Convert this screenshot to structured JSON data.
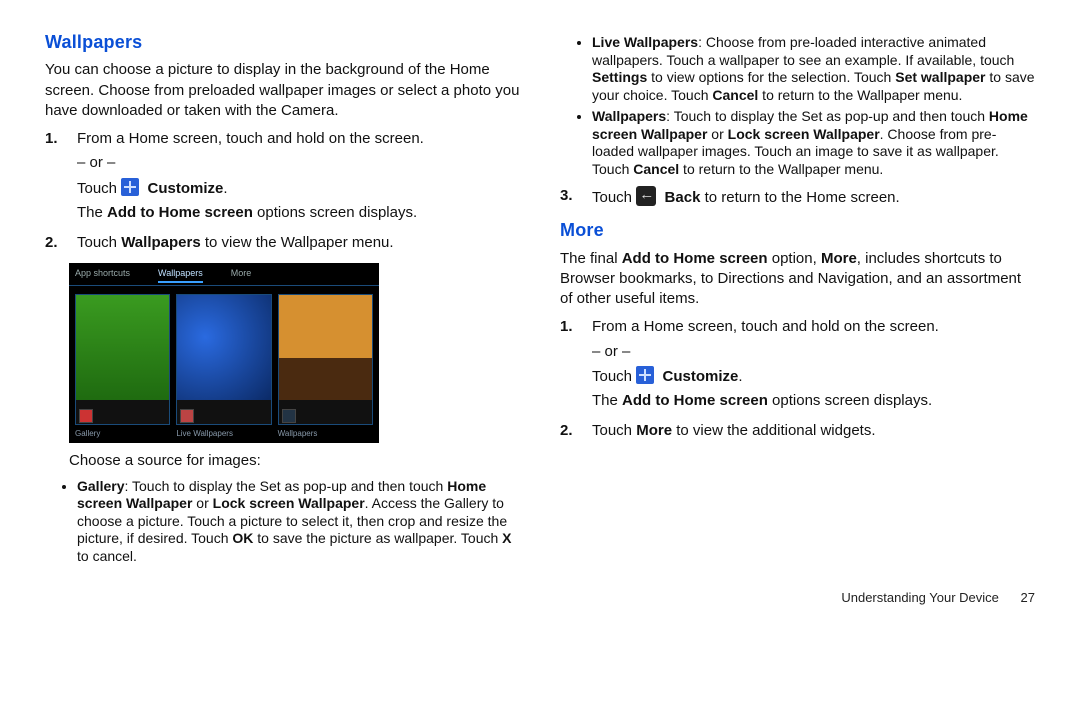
{
  "left": {
    "heading": "Wallpapers",
    "intro": "You can choose a picture to display in the background of the Home screen. Choose from preloaded wallpaper images or select a photo you have downloaded or taken with the Camera.",
    "steps": {
      "s1a": "From a Home screen, touch and hold on the screen.",
      "s1b": "– or –",
      "s1c_pre": "Touch ",
      "s1c_bold": "Customize",
      "s1d_pre": "The ",
      "s1d_bold": "Add to Home screen",
      "s1d_post": " options screen displays.",
      "s2_pre": "Touch ",
      "s2_bold": "Wallpapers",
      "s2_post": " to view the Wallpaper menu."
    },
    "screenshot": {
      "tabs": {
        "t1": "App shortcuts",
        "t2": "Wallpapers",
        "t3": "More"
      },
      "labels": {
        "l1": "Gallery",
        "l2": "Live Wallpapers",
        "l3": "Wallpapers"
      }
    },
    "choose_label": "Choose a source for images:",
    "gallery_text": "Gallery: Touch to display the Set as pop-up and then touch Home screen Wallpaper or Lock screen Wallpaper. Access the Gallery to choose a picture. Touch a picture to select it, then crop and resize the picture, if desired. Touch OK to save the picture as wallpaper. Touch X to cancel."
  },
  "right": {
    "live_text": "Live Wallpapers: Choose from pre-loaded interactive animated wallpapers. Touch a wallpaper to see an example. If available, touch Settings to view options for the selection. Touch Set wallpaper to save your choice. Touch Cancel to return to the Wallpaper menu.",
    "wall_text": "Wallpapers: Touch to display the Set as pop-up and then touch Home screen Wallpaper or Lock screen Wallpaper. Choose from pre-loaded wallpaper images. Touch an image to save it as wallpaper. Touch Cancel to return to the Wallpaper menu.",
    "s3_pre": "Touch ",
    "s3_bold": "Back",
    "s3_post": " to return to the Home screen.",
    "heading": "More",
    "more_intro_pre": "The final ",
    "more_intro_b1": "Add to Home screen",
    "more_intro_mid": " option, ",
    "more_intro_b2": "More",
    "more_intro_post": ", includes shortcuts to Browser bookmarks, to Directions and Navigation, and an assortment of other useful items.",
    "m1a": "From a Home screen, touch and hold on the screen.",
    "m1b": "– or –",
    "m1c_pre": "Touch ",
    "m1c_bold": "Customize",
    "m1d_pre": "The ",
    "m1d_bold": "Add to Home screen",
    "m1d_post": " options screen displays.",
    "m2_pre": "Touch ",
    "m2_bold": "More",
    "m2_post": " to view the additional widgets."
  },
  "footer": {
    "section": "Understanding Your Device",
    "page": "27"
  }
}
